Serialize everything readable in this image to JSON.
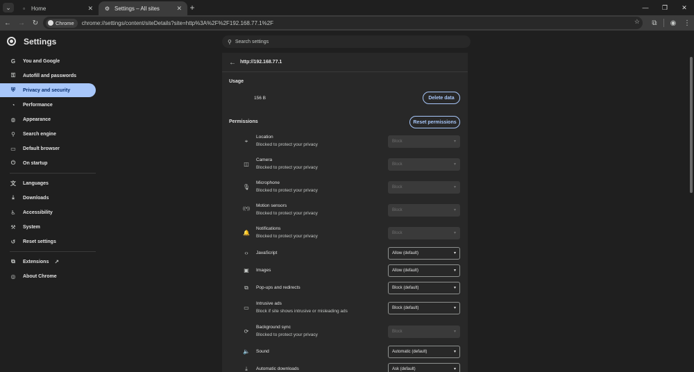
{
  "tabs": [
    {
      "title": "Home",
      "active": false
    },
    {
      "title": "Settings – All sites",
      "active": true
    }
  ],
  "toolbar": {
    "chip": "Chrome",
    "url": "chrome://settings/content/siteDetails?site=http%3A%2F%2F192.168.77.1%2F"
  },
  "header": {
    "title": "Settings",
    "search_placeholder": "Search settings"
  },
  "sidebar": {
    "items": [
      {
        "label": "You and Google",
        "icon": "google-icon"
      },
      {
        "label": "Autofill and passwords",
        "icon": "key-icon"
      },
      {
        "label": "Privacy and security",
        "icon": "shield-icon",
        "active": true
      },
      {
        "label": "Performance",
        "icon": "speedometer-icon"
      },
      {
        "label": "Appearance",
        "icon": "palette-icon"
      },
      {
        "label": "Search engine",
        "icon": "search-icon"
      },
      {
        "label": "Default browser",
        "icon": "browser-icon"
      },
      {
        "label": "On startup",
        "icon": "power-icon"
      },
      {
        "label": "Languages",
        "icon": "translate-icon"
      },
      {
        "label": "Downloads",
        "icon": "download-icon"
      },
      {
        "label": "Accessibility",
        "icon": "accessibility-icon"
      },
      {
        "label": "System",
        "icon": "wrench-icon"
      },
      {
        "label": "Reset settings",
        "icon": "reset-icon"
      },
      {
        "label": "Extensions",
        "icon": "puzzle-icon"
      },
      {
        "label": "About Chrome",
        "icon": "chrome-icon"
      }
    ]
  },
  "site": {
    "origin": "http://192.168.77.1",
    "usage_label": "Usage",
    "usage_value": "156 B",
    "delete_label": "Delete data",
    "permissions_label": "Permissions",
    "reset_label": "Reset permissions"
  },
  "permissions": [
    {
      "name": "Location",
      "desc": "Blocked to protect your privacy",
      "value": "Block",
      "enabled": false,
      "icon": "location-icon"
    },
    {
      "name": "Camera",
      "desc": "Blocked to protect your privacy",
      "value": "Block",
      "enabled": false,
      "icon": "camera-icon"
    },
    {
      "name": "Microphone",
      "desc": "Blocked to protect your privacy",
      "value": "Block",
      "enabled": false,
      "icon": "microphone-icon"
    },
    {
      "name": "Motion sensors",
      "desc": "Blocked to protect your privacy",
      "value": "Block",
      "enabled": false,
      "icon": "sensors-icon"
    },
    {
      "name": "Notifications",
      "desc": "Blocked to protect your privacy",
      "value": "Block",
      "enabled": false,
      "icon": "bell-icon"
    },
    {
      "name": "JavaScript",
      "desc": "",
      "value": "Allow (default)",
      "enabled": true,
      "icon": "code-icon"
    },
    {
      "name": "Images",
      "desc": "",
      "value": "Allow (default)",
      "enabled": true,
      "icon": "image-icon"
    },
    {
      "name": "Pop-ups and redirects",
      "desc": "",
      "value": "Block (default)",
      "enabled": true,
      "icon": "popup-icon"
    },
    {
      "name": "Intrusive ads",
      "desc": "Block if site shows intrusive or misleading ads",
      "value": "Block (default)",
      "enabled": true,
      "icon": "ads-icon"
    },
    {
      "name": "Background sync",
      "desc": "Blocked to protect your privacy",
      "value": "Block",
      "enabled": false,
      "icon": "sync-icon"
    },
    {
      "name": "Sound",
      "desc": "",
      "value": "Automatic (default)",
      "enabled": true,
      "icon": "speaker-icon"
    },
    {
      "name": "Automatic downloads",
      "desc": "",
      "value": "Ask (default)",
      "enabled": true,
      "icon": "download-icon"
    }
  ]
}
